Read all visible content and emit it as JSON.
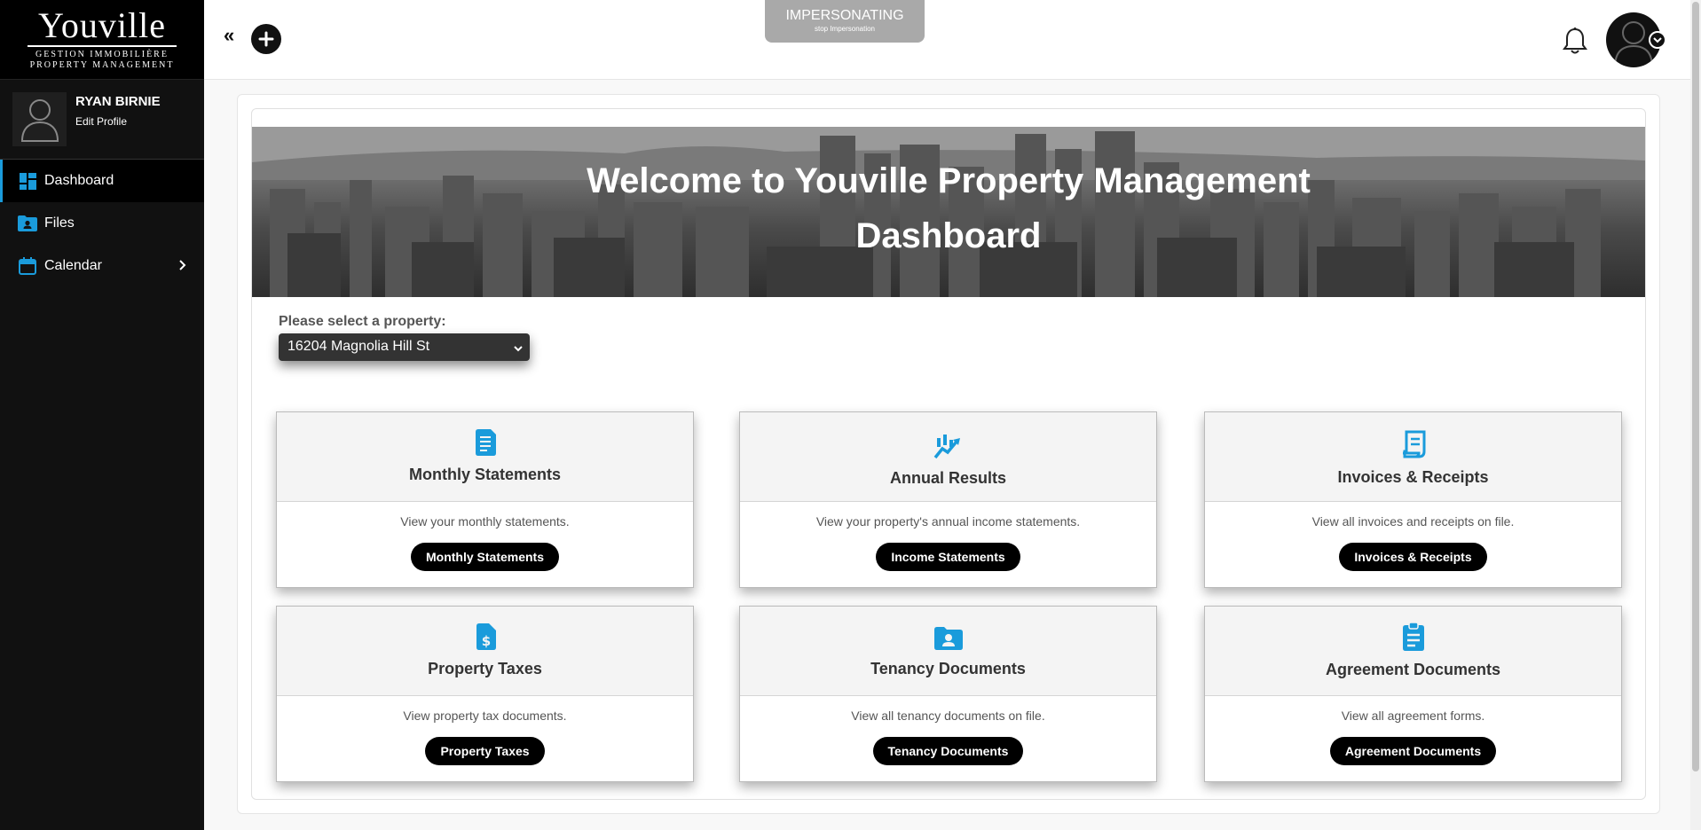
{
  "brand": {
    "logo_main": "Youville",
    "logo_sub_1": "GESTION IMMOBILIÈRE",
    "logo_sub_2": "PROPERTY MANAGEMENT"
  },
  "profile": {
    "name": "RYAN BIRNIE",
    "edit_label": "Edit Profile"
  },
  "nav": {
    "items": [
      {
        "label": "Dashboard",
        "icon": "dashboard-icon"
      },
      {
        "label": "Files",
        "icon": "folder-user-icon"
      },
      {
        "label": "Calendar",
        "icon": "calendar-icon"
      }
    ]
  },
  "topbar": {
    "collapse_label": "«",
    "impersonating_title": "IMPERSONATING",
    "impersonating_sub": "stop Impersonation"
  },
  "hero": {
    "title_line1": "Welcome to Youville Property Management",
    "title_line2": "Dashboard"
  },
  "property": {
    "label": "Please select a property:",
    "selected": "16204 Magnolia Hill St"
  },
  "cards": [
    {
      "title": "Monthly Statements",
      "desc": "View your monthly statements.",
      "button": "Monthly Statements",
      "icon": "document-icon"
    },
    {
      "title": "Annual Results",
      "desc": "View your property's annual income statements.",
      "button": "Income Statements",
      "icon": "chart-line-icon"
    },
    {
      "title": "Invoices & Receipts",
      "desc": "View all invoices and receipts on file.",
      "button": "Invoices & Receipts",
      "icon": "receipt-icon"
    },
    {
      "title": "Property Taxes",
      "desc": "View property tax documents.",
      "button": "Property Taxes",
      "icon": "tax-document-icon"
    },
    {
      "title": "Tenancy Documents",
      "desc": "View all tenancy documents on file.",
      "button": "Tenancy Documents",
      "icon": "folder-user-icon"
    },
    {
      "title": "Agreement Documents",
      "desc": "View all agreement forms.",
      "button": "Agreement Documents",
      "icon": "clipboard-icon"
    }
  ],
  "colors": {
    "accent": "#1a9bdb",
    "sidebar_bg": "#111111",
    "button_bg": "#000000"
  }
}
